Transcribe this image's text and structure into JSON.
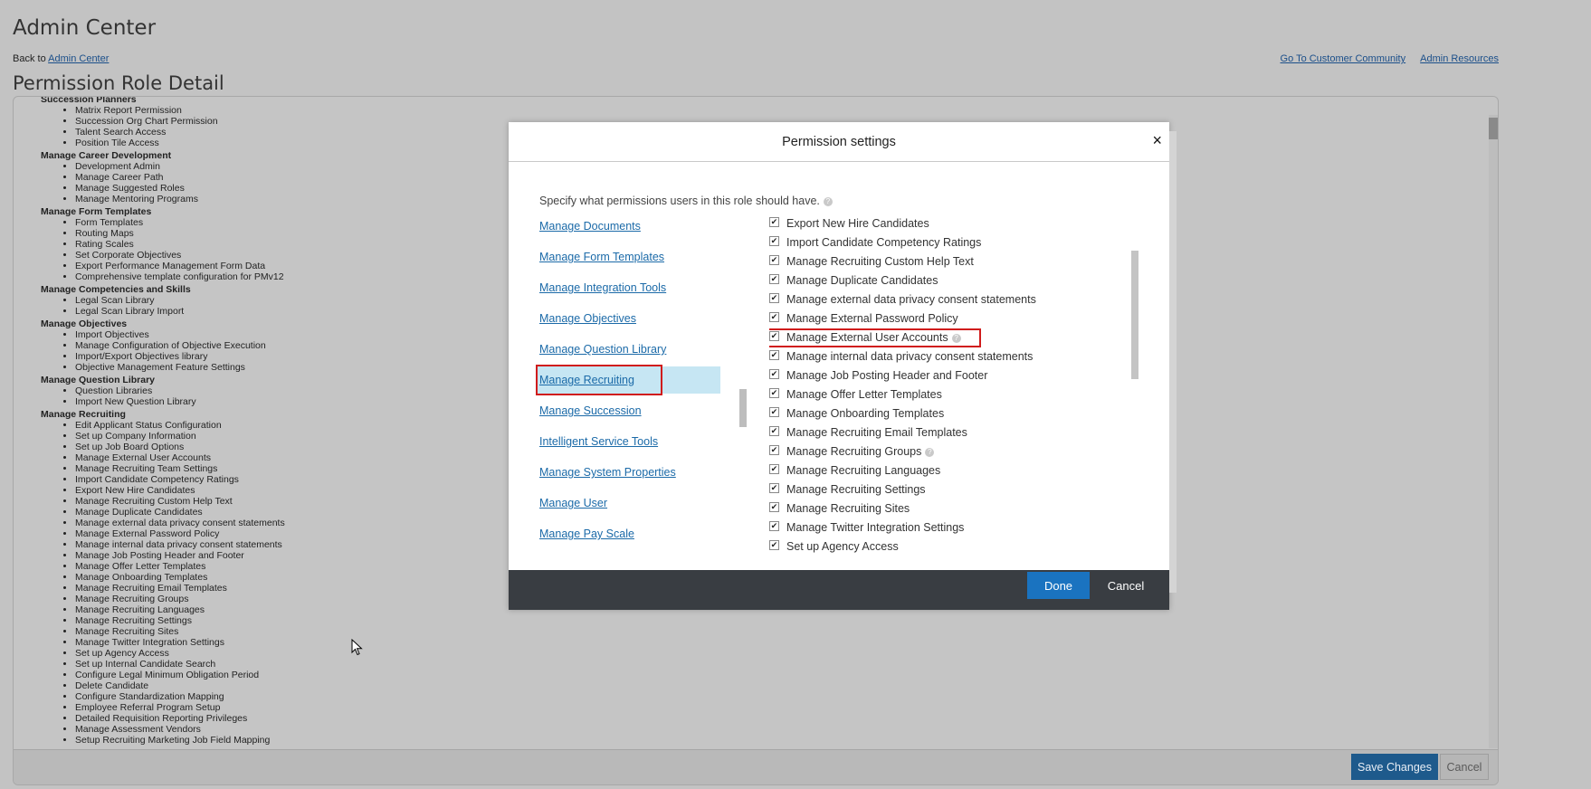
{
  "header": {
    "app_title": "Admin Center",
    "back_prefix": "Back to",
    "back_link": "Admin Center",
    "links": [
      "Go To Customer Community",
      "Admin Resources"
    ],
    "page_title": "Permission Role Detail"
  },
  "permission_groups": [
    {
      "title": "Succession Planners",
      "items": [
        "Matrix Report Permission",
        "Succession Org Chart Permission",
        "Talent Search Access",
        "Position Tile Access"
      ]
    },
    {
      "title": "Manage Career Development",
      "items": [
        "Development Admin",
        "Manage Career Path",
        "Manage Suggested Roles",
        "Manage Mentoring Programs"
      ]
    },
    {
      "title": "Manage Form Templates",
      "items": [
        "Form Templates",
        "Routing Maps",
        "Rating Scales",
        "Set Corporate Objectives",
        "Export Performance Management Form Data",
        "Comprehensive template configuration for PMv12"
      ]
    },
    {
      "title": "Manage Competencies and Skills",
      "items": [
        "Legal Scan Library",
        "Legal Scan Library Import"
      ]
    },
    {
      "title": "Manage Objectives",
      "items": [
        "Import Objectives",
        "Manage Configuration of Objective Execution",
        "Import/Export Objectives library",
        "Objective Management Feature Settings"
      ]
    },
    {
      "title": "Manage Question Library",
      "items": [
        "Question Libraries",
        "Import New Question Library"
      ]
    },
    {
      "title": "Manage Recruiting",
      "items": [
        "Edit Applicant Status Configuration",
        "Set up Company Information",
        "Set up Job Board Options",
        "Manage External User Accounts",
        "Manage Recruiting Team Settings",
        "Import Candidate Competency Ratings",
        "Export New Hire Candidates",
        "Manage Recruiting Custom Help Text",
        "Manage Duplicate Candidates",
        "Manage external data privacy consent statements",
        "Manage External Password Policy",
        "Manage internal data privacy consent statements",
        "Manage Job Posting Header and Footer",
        "Manage Offer Letter Templates",
        "Manage Onboarding Templates",
        "Manage Recruiting Email Templates",
        "Manage Recruiting Groups",
        "Manage Recruiting Languages",
        "Manage Recruiting Settings",
        "Manage Recruiting Sites",
        "Manage Twitter Integration Settings",
        "Set up Agency Access",
        "Set up Internal Candidate Search",
        "Configure Legal Minimum Obligation Period",
        "Delete Candidate",
        "Configure Standardization Mapping",
        "Employee Referral Program Setup",
        "Detailed Requisition Reporting Privileges",
        "Manage Assessment Vendors",
        "Setup Recruiting Marketing Job Field Mapping"
      ]
    }
  ],
  "footer": {
    "save_label": "Save Changes",
    "cancel_label": "Cancel"
  },
  "dialog": {
    "title": "Permission settings",
    "close_glyph": "×",
    "intro": "Specify what permissions users in this role should have.",
    "help_glyph": "?",
    "check_glyph": "✔",
    "categories": [
      "Manage Documents",
      "Manage Form Templates",
      "Manage Integration Tools",
      "Manage Objectives",
      "Manage Question Library",
      "Manage Recruiting",
      "Manage Succession",
      "Intelligent Service Tools",
      "Manage System Properties",
      "Manage User",
      "Manage Pay Scale"
    ],
    "selected_category": "Manage Recruiting",
    "permissions": [
      {
        "label": "Export New Hire Candidates",
        "checked": true
      },
      {
        "label": "Import Candidate Competency Ratings",
        "checked": true
      },
      {
        "label": "Manage Recruiting Custom Help Text",
        "checked": true
      },
      {
        "label": "Manage Duplicate Candidates",
        "checked": true
      },
      {
        "label": "Manage external data privacy consent statements",
        "checked": true
      },
      {
        "label": "Manage External Password Policy",
        "checked": true
      },
      {
        "label": "Manage External User Accounts",
        "checked": true,
        "help": true,
        "highlighted": true
      },
      {
        "label": "Manage internal data privacy consent statements",
        "checked": true
      },
      {
        "label": "Manage Job Posting Header and Footer",
        "checked": true
      },
      {
        "label": "Manage Offer Letter Templates",
        "checked": true
      },
      {
        "label": "Manage Onboarding Templates",
        "checked": true
      },
      {
        "label": "Manage Recruiting Email Templates",
        "checked": true
      },
      {
        "label": "Manage Recruiting Groups",
        "checked": true,
        "help": true
      },
      {
        "label": "Manage Recruiting Languages",
        "checked": true
      },
      {
        "label": "Manage Recruiting Settings",
        "checked": true
      },
      {
        "label": "Manage Recruiting Sites",
        "checked": true
      },
      {
        "label": "Manage Twitter Integration Settings",
        "checked": true
      },
      {
        "label": "Set up Agency Access",
        "checked": true
      }
    ],
    "done_label": "Done",
    "cancel_label": "Cancel"
  },
  "colors": {
    "overlay_bg": "#c3c3c3",
    "link": "#1b6aa8",
    "selected_bg": "#c6e6f3",
    "highlight_border": "#d01c1c",
    "primary_button": "#1a73c0",
    "dialog_footer": "#393d42"
  },
  "icons": [
    "close-icon",
    "help-icon",
    "checkbox-checked-icon",
    "cursor-arrow-icon"
  ]
}
